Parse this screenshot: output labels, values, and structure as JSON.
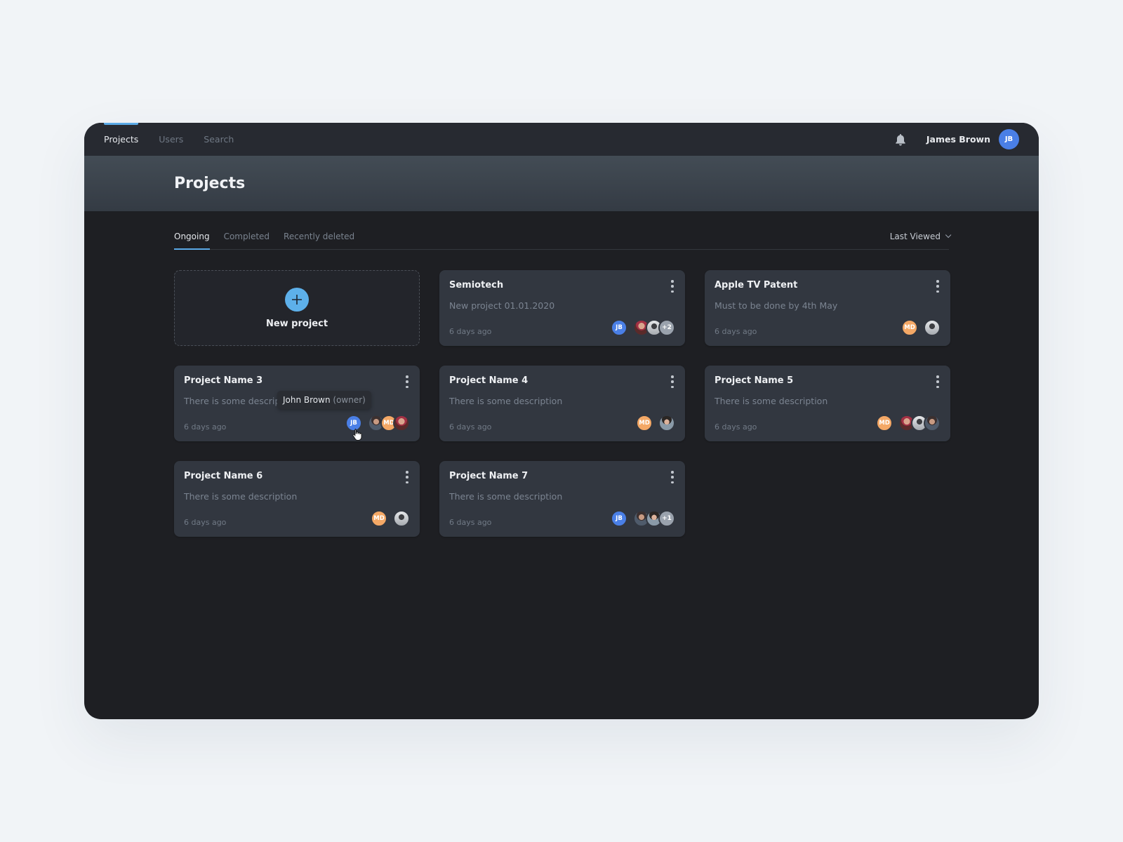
{
  "nav": {
    "items": [
      {
        "label": "Projects",
        "active": true
      },
      {
        "label": "Users",
        "active": false
      },
      {
        "label": "Search",
        "active": false
      }
    ],
    "notification_icon": "bell-icon",
    "user": {
      "name": "James Brown",
      "initials": "JB",
      "avatar_color": "#4a7fe6"
    }
  },
  "header": {
    "title": "Projects"
  },
  "tabs": [
    {
      "label": "Ongoing",
      "active": true
    },
    {
      "label": "Completed",
      "active": false
    },
    {
      "label": "Recently deleted",
      "active": false
    }
  ],
  "sort": {
    "label": "Last Viewed",
    "icon": "chevron-down-icon"
  },
  "new_project": {
    "label": "New project",
    "icon": "plus-icon",
    "accent": "#5db0ea"
  },
  "projects": [
    {
      "title": "Semiotech",
      "description": "New project 01.01.2020",
      "time": "6 days ago",
      "owner": "JB",
      "members": [
        "photo",
        "photo"
      ],
      "more": "+2"
    },
    {
      "title": "Apple TV Patent",
      "description": "Must to be done by 4th May",
      "time": "6 days ago",
      "owner": "MD",
      "members": [
        "photo"
      ],
      "more": null
    },
    {
      "title": "Project Name 3",
      "description": "There is some description",
      "time": "6 days ago",
      "owner": "JB",
      "members": [
        "photo",
        "MD",
        "photo"
      ],
      "more": null
    },
    {
      "title": "Project Name 4",
      "description": "There is some description",
      "time": "6 days ago",
      "owner": "MD",
      "members": [
        "photo"
      ],
      "more": null
    },
    {
      "title": "Project Name 5",
      "description": "There is some description",
      "time": "6 days ago",
      "owner": "MD",
      "members": [
        "photo",
        "photo",
        "photo"
      ],
      "more": null
    },
    {
      "title": "Project Name 6",
      "description": "There is some description",
      "time": "6 days ago",
      "owner": "MD",
      "members": [
        "photo"
      ],
      "more": null
    },
    {
      "title": "Project Name 7",
      "description": "There is some description",
      "time": "6 days ago",
      "owner": "JB",
      "members": [
        "photo",
        "photo"
      ],
      "more": "+1"
    }
  ],
  "tooltip": {
    "name": "John Brown",
    "role": "(owner)"
  },
  "colors": {
    "accent": "#5aa9e6",
    "jb_avatar": "#4a7fe6",
    "md_avatar": "#f4a866"
  }
}
